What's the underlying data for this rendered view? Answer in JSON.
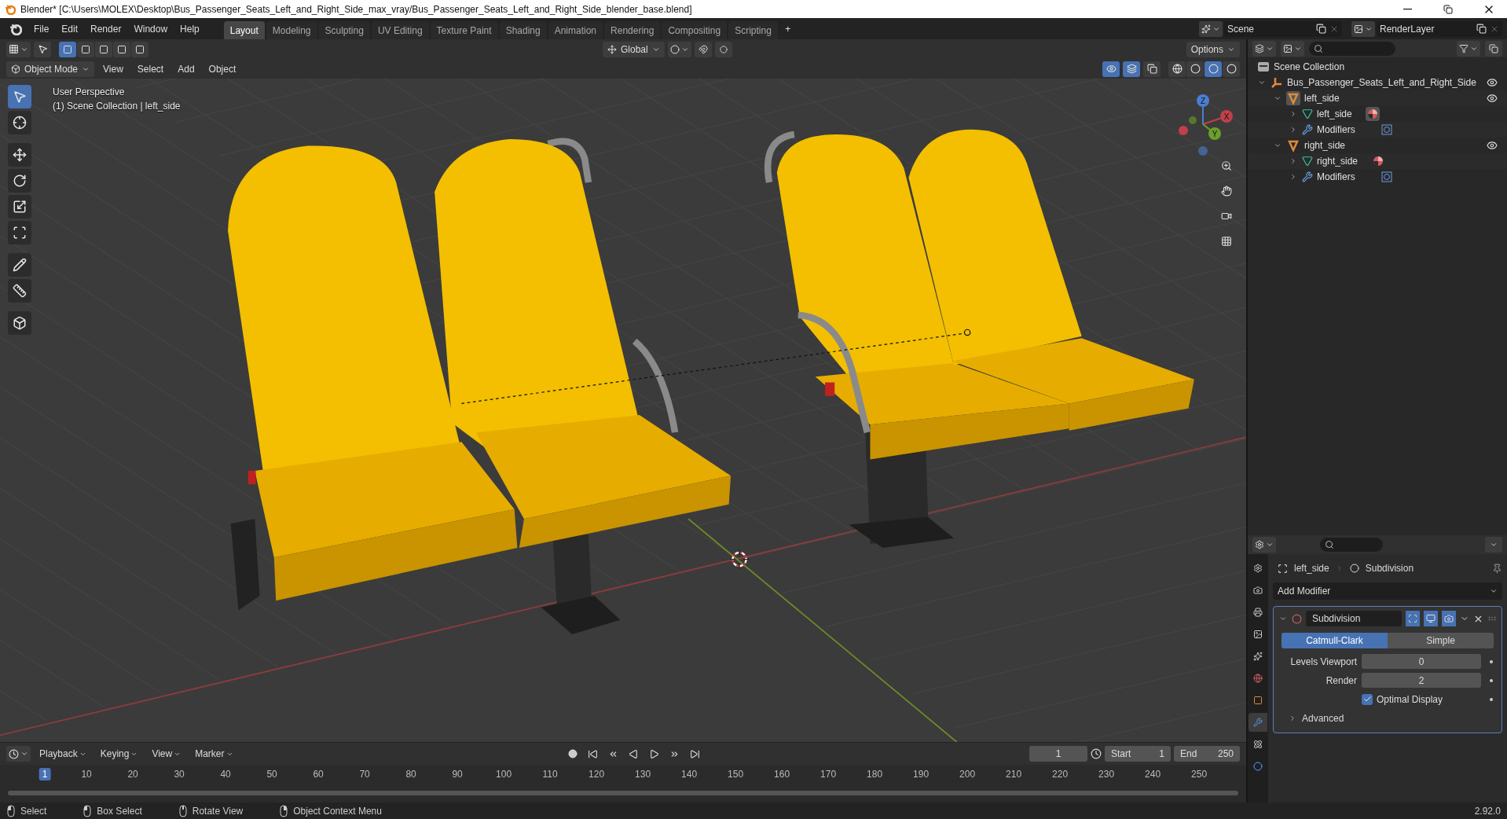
{
  "window": {
    "title": "Blender* [C:\\Users\\MOLEX\\Desktop\\Bus_Passenger_Seats_Left_and_Right_Side_max_vray/Bus_Passenger_Seats_Left_and_Right_Side_blender_base.blend]"
  },
  "menu": [
    "File",
    "Edit",
    "Render",
    "Window",
    "Help"
  ],
  "workspaces": [
    {
      "label": "Layout",
      "selected": true
    },
    {
      "label": "Modeling",
      "selected": false
    },
    {
      "label": "Sculpting",
      "selected": false
    },
    {
      "label": "UV Editing",
      "selected": false
    },
    {
      "label": "Texture Paint",
      "selected": false
    },
    {
      "label": "Shading",
      "selected": false
    },
    {
      "label": "Animation",
      "selected": false
    },
    {
      "label": "Rendering",
      "selected": false
    },
    {
      "label": "Compositing",
      "selected": false
    },
    {
      "label": "Scripting",
      "selected": false
    }
  ],
  "add_workspace": "+",
  "scene": "Scene",
  "view_layer": "RenderLayer",
  "tool_header": {
    "select_modes": [
      {
        "selected": true
      },
      {
        "selected": false
      },
      {
        "selected": false
      },
      {
        "selected": false
      },
      {
        "selected": false
      }
    ],
    "orientation": "Global",
    "options": "Options"
  },
  "mode_header": {
    "mode": "Object Mode",
    "menus": [
      "View",
      "Select",
      "Add",
      "Object"
    ],
    "toggles": [
      {
        "kind": "gizmo",
        "on": true
      },
      {
        "kind": "overlay",
        "on": true
      },
      {
        "kind": "xray",
        "on": false
      }
    ],
    "shading": [
      {
        "kind": "wireframe",
        "selected": false
      },
      {
        "kind": "solid",
        "selected": false
      },
      {
        "kind": "material",
        "selected": true
      },
      {
        "kind": "rendered",
        "selected": false
      }
    ]
  },
  "tools": [
    {
      "kind": "select",
      "selected": true
    },
    {
      "kind": "cursor",
      "selected": false
    },
    {
      "kind": "move",
      "selected": false
    },
    {
      "kind": "rotate",
      "selected": false
    },
    {
      "kind": "scale",
      "selected": false
    },
    {
      "kind": "transform",
      "selected": false
    },
    {
      "kind": "annotate",
      "selected": false
    },
    {
      "kind": "measure",
      "selected": false
    },
    {
      "kind": "add-cube",
      "selected": false
    }
  ],
  "viewport": {
    "perspective": "User Perspective",
    "context": "(1) Scene Collection | left_side",
    "gizmo": {
      "x": "X",
      "y": "Y",
      "z": "Z"
    }
  },
  "outliner": {
    "root": "Scene Collection",
    "items": [
      {
        "label": "Bus_Passenger_Seats_Left_and_Right_Side",
        "kind": "empty",
        "expanded": true,
        "visible": true,
        "children": [
          {
            "label": "left_side",
            "kind": "object",
            "expanded": true,
            "visible": true,
            "active": true,
            "children": [
              {
                "label": "left_side",
                "kind": "mesh",
                "expanded": false,
                "active": true
              },
              {
                "label": "Modifiers",
                "kind": "modifiers",
                "expanded": false
              }
            ]
          },
          {
            "label": "right_side",
            "kind": "object",
            "expanded": true,
            "visible": true,
            "active": false,
            "children": [
              {
                "label": "right_side",
                "kind": "mesh",
                "expanded": false,
                "active": false
              },
              {
                "label": "Modifiers",
                "kind": "modifiers",
                "expanded": false
              }
            ]
          }
        ]
      }
    ]
  },
  "properties": {
    "tabs": [
      {
        "kind": "tool",
        "selected": false
      },
      {
        "kind": "render",
        "selected": false
      },
      {
        "kind": "output",
        "selected": false
      },
      {
        "kind": "view-layer",
        "selected": false
      },
      {
        "kind": "scene",
        "selected": false
      },
      {
        "kind": "world",
        "selected": false
      },
      {
        "kind": "object",
        "selected": false
      },
      {
        "kind": "modifiers",
        "selected": true
      },
      {
        "kind": "particles",
        "selected": false
      },
      {
        "kind": "physics",
        "selected": false
      }
    ],
    "object": "left_side",
    "modifier_crumb": "Subdivision",
    "add_modifier": "Add Modifier",
    "modifier": {
      "name": "Subdivision",
      "expanded": true,
      "display": [
        {
          "kind": "edit-mode",
          "on": true
        },
        {
          "kind": "viewport",
          "on": true
        },
        {
          "kind": "render",
          "on": true
        }
      ],
      "types": [
        {
          "label": "Catmull-Clark",
          "selected": true
        },
        {
          "label": "Simple",
          "selected": false
        }
      ],
      "fields": [
        {
          "label": "Levels Viewport",
          "value": "0"
        },
        {
          "label": "Render",
          "value": "2"
        }
      ],
      "optimal_display": {
        "label": "Optimal Display",
        "checked": true
      },
      "advanced": {
        "label": "Advanced",
        "expanded": false
      }
    }
  },
  "timeline": {
    "menus": [
      "Playback",
      "Keying",
      "View",
      "Marker"
    ],
    "current_frame": "1",
    "start_label": "Start",
    "start": "1",
    "end_label": "End",
    "end": "250",
    "ticks": [
      {
        "label": "1",
        "selected": true
      },
      {
        "label": "10",
        "selected": false
      },
      {
        "label": "20",
        "selected": false
      },
      {
        "label": "30",
        "selected": false
      },
      {
        "label": "40",
        "selected": false
      },
      {
        "label": "50",
        "selected": false
      },
      {
        "label": "60",
        "selected": false
      },
      {
        "label": "70",
        "selected": false
      },
      {
        "label": "80",
        "selected": false
      },
      {
        "label": "90",
        "selected": false
      },
      {
        "label": "100",
        "selected": false
      },
      {
        "label": "110",
        "selected": false
      },
      {
        "label": "120",
        "selected": false
      },
      {
        "label": "130",
        "selected": false
      },
      {
        "label": "140",
        "selected": false
      },
      {
        "label": "150",
        "selected": false
      },
      {
        "label": "160",
        "selected": false
      },
      {
        "label": "170",
        "selected": false
      },
      {
        "label": "180",
        "selected": false
      },
      {
        "label": "190",
        "selected": false
      },
      {
        "label": "200",
        "selected": false
      },
      {
        "label": "210",
        "selected": false
      },
      {
        "label": "220",
        "selected": false
      },
      {
        "label": "230",
        "selected": false
      },
      {
        "label": "240",
        "selected": false
      },
      {
        "label": "250",
        "selected": false
      }
    ]
  },
  "status_bar": {
    "hints": [
      {
        "kind": "left",
        "label": "Select"
      },
      {
        "kind": "left",
        "label": "Box Select"
      },
      {
        "kind": "middle",
        "label": "Rotate View"
      },
      {
        "kind": "right",
        "label": "Object Context Menu"
      }
    ],
    "version": "2.92.0"
  }
}
